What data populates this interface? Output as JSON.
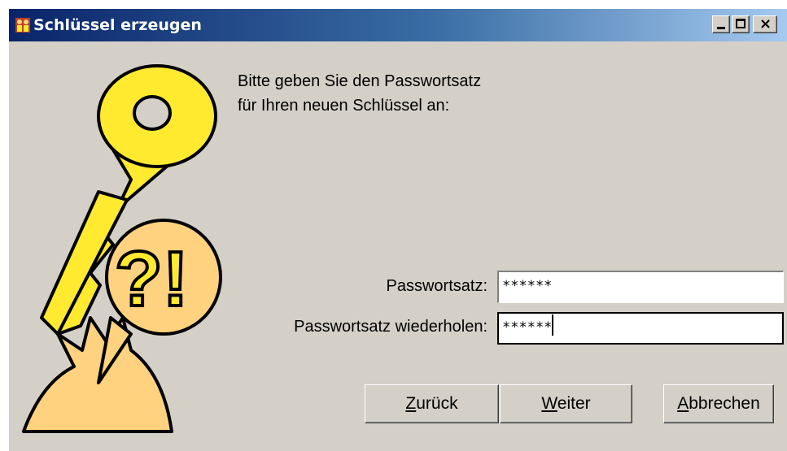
{
  "window": {
    "title": "Schlüssel erzeugen",
    "controls": {
      "minimize": "minimize",
      "maximize": "maximize",
      "close": "close"
    }
  },
  "prompt": {
    "line1": "Bitte geben Sie den Passwortsatz",
    "line2": "für Ihren neuen Schlüssel an:"
  },
  "form": {
    "passphrase_label": "Passwortsatz:",
    "passphrase_value": "******",
    "repeat_label": "Passwortsatz wiederholen:",
    "repeat_value": "******"
  },
  "buttons": {
    "back_mnemonic": "Z",
    "back_rest": "urück",
    "next_mnemonic": "W",
    "next_rest": "eiter",
    "cancel_mnemonic": "A",
    "cancel_rest": "bbrechen"
  },
  "colors": {
    "title_start": "#0a246a",
    "title_end": "#a6caf0",
    "dialog_bg": "#d4d0c8",
    "key": "#ffea30",
    "bubble": "#ffd27f"
  },
  "icons": [
    "app-icon",
    "key-icon",
    "question-exclamation-icon"
  ]
}
